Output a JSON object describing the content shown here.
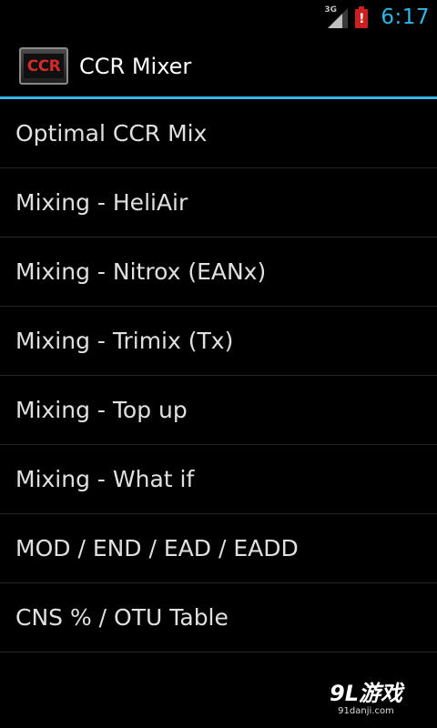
{
  "status_bar": {
    "network_type": "3G",
    "battery_alert": "!",
    "clock": "6:17",
    "icons": [
      "signal-icon",
      "battery-alert-icon"
    ]
  },
  "action_bar": {
    "app_icon_text": "CCR",
    "title": "CCR Mixer"
  },
  "menu": {
    "items": [
      {
        "label": "Optimal CCR Mix"
      },
      {
        "label": "Mixing - HeliAir"
      },
      {
        "label": "Mixing - Nitrox (EANx)"
      },
      {
        "label": "Mixing - Trimix (Tx)"
      },
      {
        "label": "Mixing - Top up"
      },
      {
        "label": "Mixing - What if"
      },
      {
        "label": "MOD / END / EAD / EADD"
      },
      {
        "label": "CNS % / OTU Table"
      }
    ]
  },
  "watermark": {
    "logo": "9L游戏",
    "url": "91danji.com"
  },
  "colors": {
    "accent": "#33b5e5",
    "background": "#000000",
    "battery_alert": "#cc1f1f",
    "app_icon_text": "#d42a2a"
  }
}
